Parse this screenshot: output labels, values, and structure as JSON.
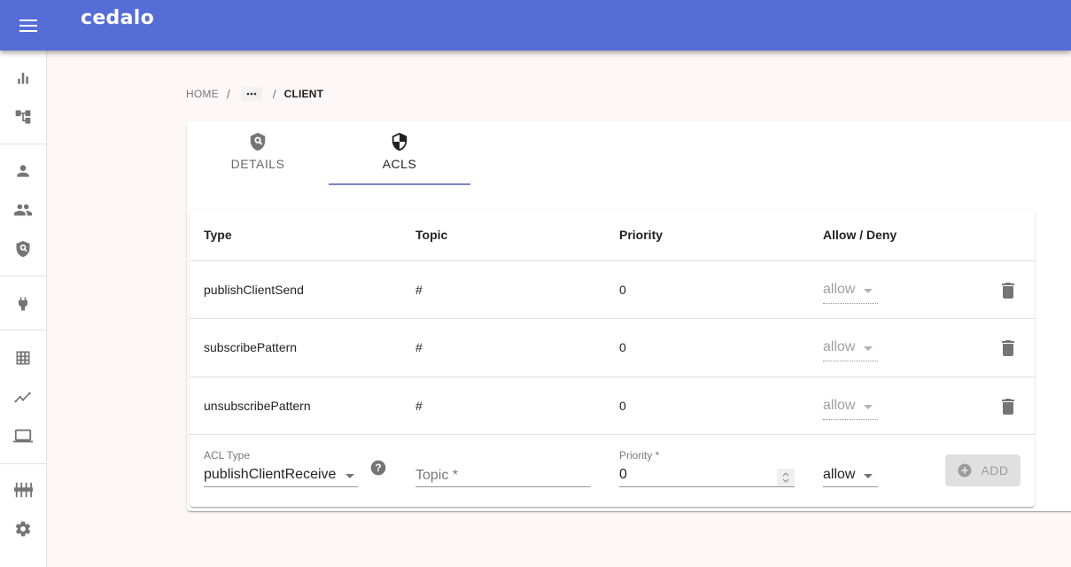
{
  "app": {
    "logo": "cedalo",
    "accent_color": "#566dd7"
  },
  "sidebar": {
    "items": [
      {
        "name": "dashboard",
        "icon": "bar-chart-icon"
      },
      {
        "name": "topic-tree",
        "icon": "account-tree-icon"
      },
      {
        "name": "clients",
        "icon": "person-icon"
      },
      {
        "name": "groups",
        "icon": "people-icon"
      },
      {
        "name": "roles",
        "icon": "policy-shield-icon"
      },
      {
        "name": "connections",
        "icon": "power-plug-icon"
      },
      {
        "name": "streams",
        "icon": "grid-icon"
      },
      {
        "name": "timeseries",
        "icon": "timeline-icon"
      },
      {
        "name": "devices",
        "icon": "laptop-icon"
      },
      {
        "name": "plugins",
        "icon": "tune-sliders-icon"
      },
      {
        "name": "settings",
        "icon": "gear-icon"
      }
    ]
  },
  "breadcrumb": {
    "home": "HOME",
    "separator": "/",
    "more": "···",
    "current": "CLIENT"
  },
  "tabs": [
    {
      "label": "DETAILS",
      "icon": "policy-shield-icon",
      "selected": false
    },
    {
      "label": "ACLS",
      "icon": "security-shield-icon",
      "selected": true
    }
  ],
  "acl_table": {
    "headers": [
      "Type",
      "Topic",
      "Priority",
      "Allow / Deny"
    ],
    "rows": [
      {
        "type": "publishClientSend",
        "topic": "#",
        "priority": "0",
        "allow": "allow"
      },
      {
        "type": "subscribePattern",
        "topic": "#",
        "priority": "0",
        "allow": "allow"
      },
      {
        "type": "unsubscribePattern",
        "topic": "#",
        "priority": "0",
        "allow": "allow"
      }
    ]
  },
  "add_form": {
    "acl_type_label": "ACL Type",
    "acl_type_value": "publishClientReceive",
    "topic_placeholder": "Topic *",
    "topic_value": "",
    "priority_label": "Priority *",
    "priority_value": "0",
    "allow_value": "allow",
    "add_button": "ADD"
  }
}
